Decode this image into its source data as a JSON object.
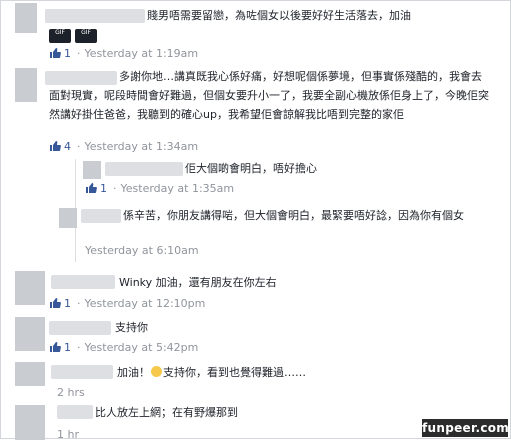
{
  "comments": [
    {
      "text": "賤男唔需要留戀，為咗個女以後要好好生活落去，加油",
      "stickers": [
        "GIF",
        "GIF"
      ],
      "likes": "1",
      "time": "Yesterday at 1:19am"
    },
    {
      "text": "多謝你地…講真既我心係好痛，好想呢個係夢境，但事實係殘酷的，我會去面對現實，呢段時間會好難過，但個女要升小一了，我要全副心機放係佢身上了，今晚佢突然講好掛住爸爸，我聽到的確心up，我希望佢會諒解我比唔到完整的家佢",
      "likes": "4",
      "time": "Yesterday at 1:34am",
      "replies": [
        {
          "text": "佢大個啲會明白，唔好擔心",
          "likes": "1",
          "time": "Yesterday at 1:35am"
        },
        {
          "text": "係辛苦，你朋友講得啱，但大個會明白，最緊要唔好諗，因為你有個女",
          "time": "Yesterday at 6:10am"
        }
      ]
    },
    {
      "text": "Winky 加油，還有朋友在你左右",
      "likes": "1",
      "time": "Yesterday at 12:10pm"
    },
    {
      "text": "支持你",
      "likes": "1",
      "time": "Yesterday at 5:42pm"
    },
    {
      "text_before": "加油！",
      "text_after": "支持你，看到也覺得難過……",
      "time": "2 hrs"
    },
    {
      "text": "比人放左上網；在有野爆那到",
      "time": "1 hr"
    }
  ],
  "watermark": "funpeer.com",
  "colors": {
    "link": "#365899",
    "meta": "#90949c",
    "text": "#1d2129"
  }
}
